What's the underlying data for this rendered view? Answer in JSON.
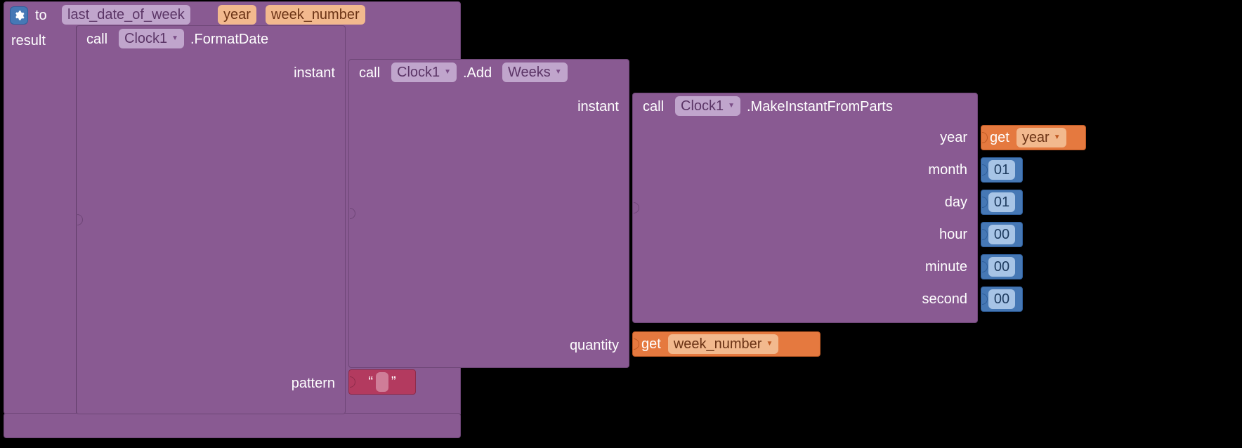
{
  "proc": {
    "to_kw": "to",
    "name": "last_date_of_week",
    "params": [
      "year",
      "week_number"
    ],
    "result_kw": "result"
  },
  "call_kw": "call",
  "get_kw": "get",
  "component": "Clock1",
  "fd": {
    "method": ".FormatDate",
    "args": {
      "instant": "instant",
      "pattern": "pattern"
    },
    "pattern_value": " "
  },
  "add": {
    "method": ".Add",
    "unit": "Weeks",
    "args": {
      "instant": "instant",
      "quantity": "quantity"
    }
  },
  "make": {
    "method": ".MakeInstantFromParts",
    "args": {
      "year": "year",
      "month": "month",
      "day": "day",
      "hour": "hour",
      "minute": "minute",
      "second": "second"
    }
  },
  "get_vars": {
    "year": "year",
    "week_number": "week_number"
  },
  "nums": {
    "month": "01",
    "day": "01",
    "hour": "00",
    "minute": "00",
    "second": "00"
  },
  "quote": {
    "open": "“",
    "close": "”"
  }
}
